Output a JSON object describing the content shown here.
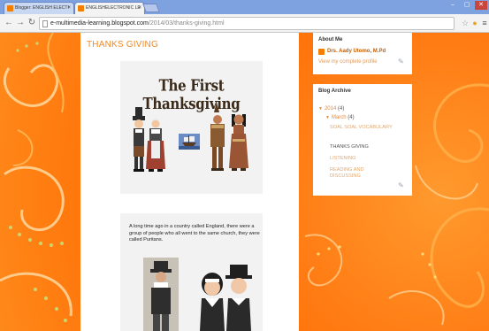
{
  "browser": {
    "tabs": [
      {
        "label": "Blogger: ENGLISH ELECTI"
      },
      {
        "label": "ENGLISHELECTRONIC LE"
      }
    ],
    "url": {
      "host": "e-multimedia-learning.blogspot.com",
      "path": "/2014/03/thanks-giving.html"
    },
    "window_controls": {
      "minimize": "–",
      "maximize": "▢",
      "close": "✕"
    }
  },
  "post": {
    "title": "THANKS GIVING",
    "image1_title": "The First Thanksgiving",
    "image2_text": "A long time ago in a country called England, there were a group of people who all went to the same church, they were called Puritans."
  },
  "sidebar": {
    "about": {
      "title": "About Me",
      "name": "Drs. Aady Utomo, M.Pd",
      "profile_link": "View my complete profile"
    },
    "archive": {
      "title": "Blog Archive",
      "year": {
        "label": "2014",
        "count": "(4)"
      },
      "month": {
        "label": "March",
        "count": "(4)"
      },
      "posts": [
        "SOAL SOAL VOCABULARY",
        "THANKS GIVING",
        "LISTENING",
        "READING AND DISCUSSING"
      ]
    }
  },
  "colors": {
    "accent": "#f08a28",
    "background_orange": "#ff7a12",
    "link": "#e49a57"
  }
}
